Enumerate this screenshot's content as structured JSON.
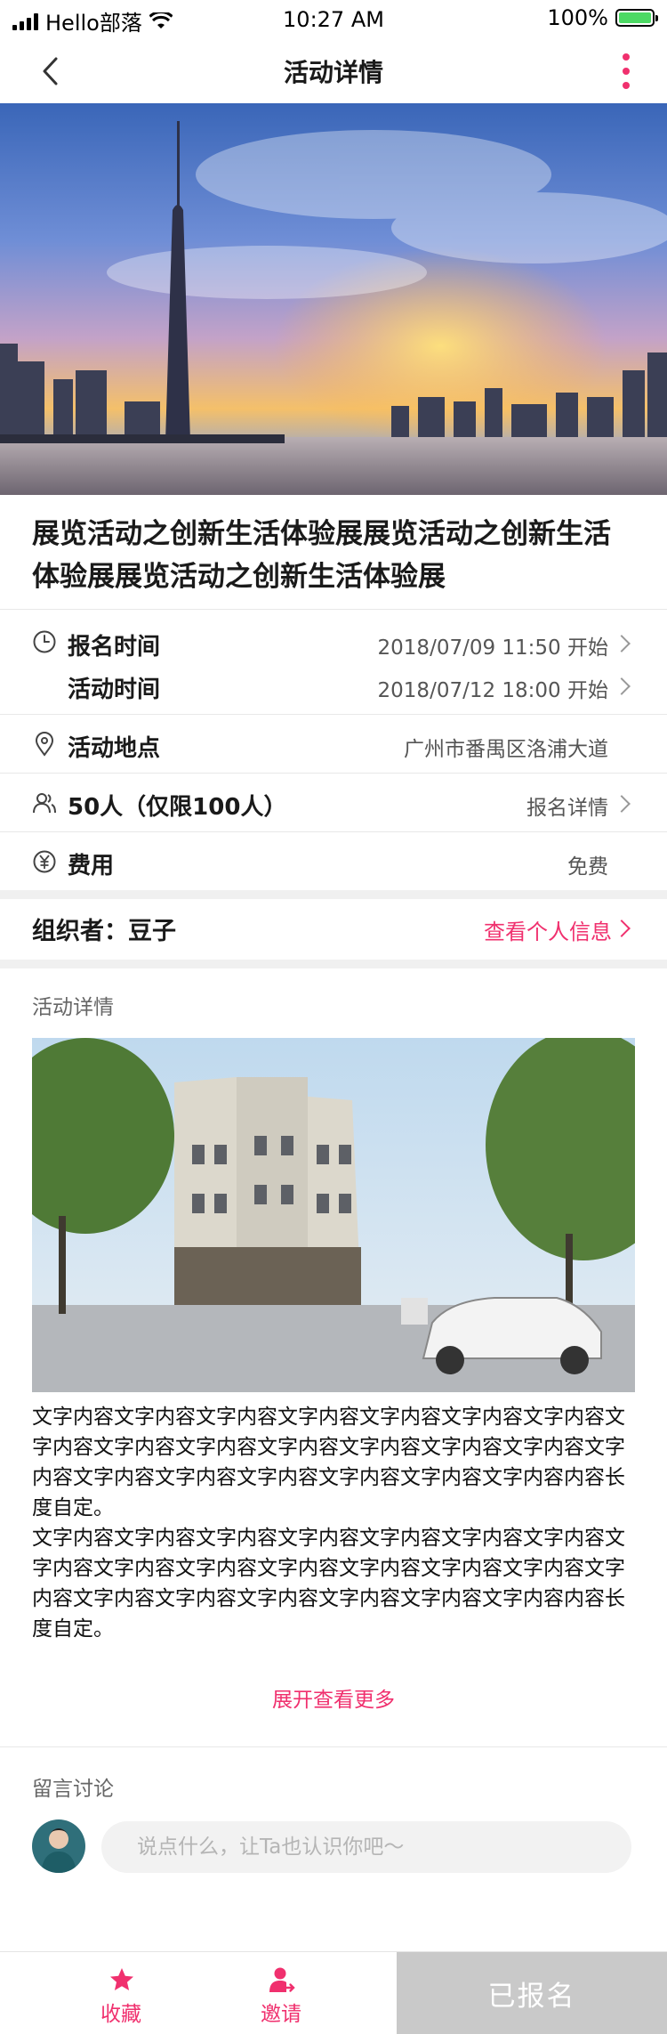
{
  "status_bar": {
    "carrier": "Hello部落",
    "time": "10:27 AM",
    "battery": "100%",
    "battery_level": 1.0
  },
  "nav": {
    "title": "活动详情"
  },
  "event": {
    "title": "展览活动之创新生活体验展展览活动之创新生活体验展展览活动之创新生活体验展",
    "signup_time_label": "报名时间",
    "signup_time_value": "2018/07/09 11:50 开始",
    "event_time_label": "活动时间",
    "event_time_value": "2018/07/12 18:00 开始",
    "location_label": "活动地点",
    "location_value": "广州市番禺区洛浦大道",
    "people_label": "50人（仅限100人）",
    "people_link": "报名详情",
    "fee_label": "费用",
    "fee_value": "免费"
  },
  "organizer": {
    "label": "组织者：豆子",
    "link": "查看个人信息"
  },
  "details": {
    "section_title": "活动详情",
    "text": "文字内容文字内容文字内容文字内容文字内容文字内容文字内容文字内容文字内容文字内容文字内容文字内容文字内容文字内容文字内容文字内容文字内容文字内容文字内容文字内容文字内容内容长度自定。\n文字内容文字内容文字内容文字内容文字内容文字内容文字内容文字内容文字内容文字内容文字内容文字内容文字内容文字内容文字内容文字内容文字内容文字内容文字内容文字内容文字内容内容长度自定。",
    "expand": "展开查看更多"
  },
  "comments": {
    "section_title": "留言讨论",
    "placeholder": "说点什么，让Ta也认识你吧～"
  },
  "tabbar": {
    "favorite": "收藏",
    "invite": "邀请",
    "signup": "已报名"
  },
  "colors": {
    "accent": "#f0306e",
    "disabled": "#c9c9c9"
  }
}
